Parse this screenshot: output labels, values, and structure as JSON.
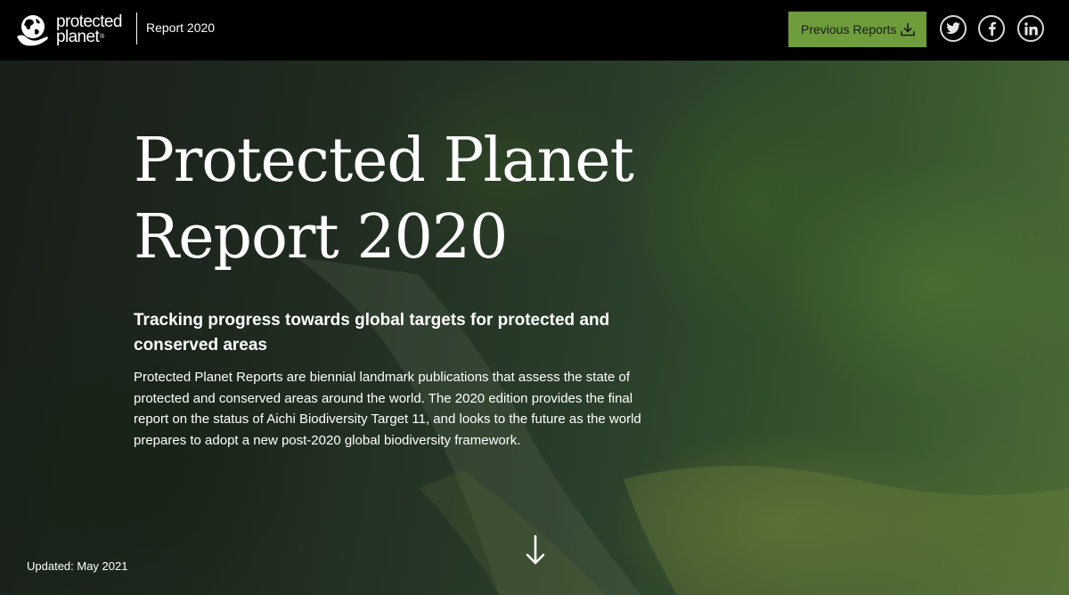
{
  "header": {
    "logo_line1": "protected",
    "logo_line2": "planet",
    "logo_mark": "®",
    "report_label": "Report 2020",
    "prev_button_label": "Previous Reports",
    "prev_button_icon": "download-icon",
    "social": [
      {
        "name": "twitter",
        "icon": "twitter-icon"
      },
      {
        "name": "facebook",
        "icon": "facebook-icon"
      },
      {
        "name": "linkedin",
        "icon": "linkedin-icon"
      }
    ],
    "colors": {
      "bar": "#000000",
      "button": "#6e9d3a",
      "button_text": "#1a1a1a"
    }
  },
  "hero": {
    "title_line1": "Protected Planet",
    "title_line2": "Report 2020",
    "subtitle": "Tracking progress towards global targets for protected and conserved areas",
    "body": "Protected Planet Reports are biennial landmark publications that assess the state of protected and conserved areas around the world. The 2020 edition provides the final report on the status of Aichi Biodiversity Target 11, and looks to the future as the world prepares to adopt a new post-2020 global biodiversity framework.",
    "updated": "Updated: May 2021",
    "scroll_icon": "arrow-down-icon"
  }
}
